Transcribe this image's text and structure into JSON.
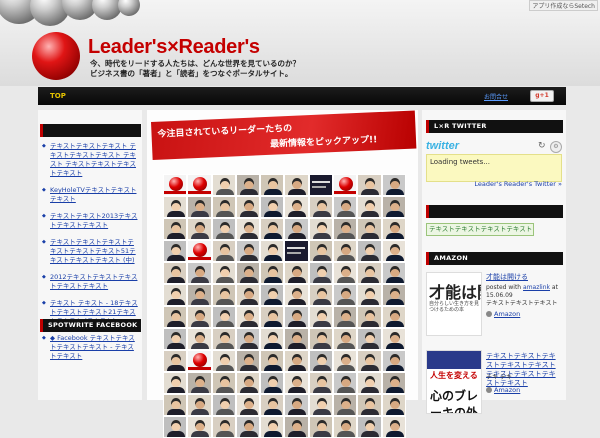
{
  "header": {
    "logo": "Leader's×Reader's",
    "tagline_line1": "今、時代をリードする人たちは、どんな世界を見ているのか？",
    "tagline_line2": "ビジネス書の「著者」と「読者」をつなぐポータルサイト。",
    "corner_text": "アプリ作成ならSetech"
  },
  "nav": {
    "top_label": "TOP",
    "link_label": "お問合せ",
    "gplus_label": "g+1"
  },
  "left_sidebar": {
    "items": [
      "テキストテキストテキスト テキストテキストテキスト テキスト テキストテキストテキストテキスト",
      "KeyHoleTVテキストテキストテキスト",
      "テキストテキスト2013テキストテキストテキスト",
      "テキストテキストテキストテキストテキストテキスト51テキストテキストテキスト (中)",
      "2012テキストテキストテキストテキストテキスト",
      "テキスト テキスト - 18テキストテキストテキスト21テキストテキスト (テキスト)",
      "◆ Facebook テキストテキストテキストテキスト - テキストテキスト"
    ],
    "spotwrite_title": "SPOTWRITE FACEBOOK"
  },
  "main": {
    "banner_line1": "今注目されているリーダーたちの",
    "banner_line2": "最新情報をピックアップ!!"
  },
  "right_sidebar": {
    "twitter_title": "L×R TWITTER",
    "twitter_logo": "twitter",
    "loading": "Loading tweets...",
    "twitter_link": "Leader's Reader's Twitter »",
    "subscribe_label": "テキストテキストテキストテキスト",
    "amazon_title": "AMAZON",
    "books": [
      {
        "cover_title": "才能は開ける",
        "cover_sub": "自分らしい生き方を見つけるための本",
        "title": "才能は開ける",
        "posted_prefix": "posted with",
        "posted_link": "amazlink",
        "posted_suffix": "at",
        "date": "15.06.09",
        "author": "テキストテキストテキスト",
        "amazon_label": "Amazon"
      },
      {
        "cover_banner": "人生を変える",
        "cover_big": "心のブレーキの外し方",
        "title": "テキストテキストテキストテキストテキストテキストテキストテキストテキスト",
        "author": "テキ テキ",
        "amazon_label": "Amazon"
      }
    ]
  },
  "colors": {
    "accent_red": "#c40000",
    "nav_bg": "#111111",
    "link_blue": "#1a3fa8",
    "twitter_blue": "#3ab2e3"
  },
  "photo_tiles": [
    "logo",
    "logo",
    "person",
    "person",
    "person",
    "person",
    "text",
    "logo",
    "person",
    "person",
    "person",
    "person",
    "person",
    "person",
    "person",
    "person",
    "person",
    "person",
    "person",
    "person",
    "person",
    "person",
    "person",
    "person",
    "person",
    "person",
    "person",
    "person",
    "person",
    "person",
    "person",
    "logo",
    "person",
    "person",
    "person",
    "text",
    "person",
    "person",
    "person",
    "person",
    "person",
    "person",
    "person",
    "person",
    "person",
    "person",
    "person",
    "person",
    "person",
    "person",
    "person",
    "person",
    "person",
    "person",
    "person",
    "person",
    "person",
    "person",
    "person",
    "person",
    "person",
    "person",
    "person",
    "person",
    "person",
    "person",
    "person",
    "person",
    "person",
    "person",
    "person",
    "person",
    "person",
    "person",
    "person",
    "person",
    "person",
    "person",
    "person",
    "person",
    "person",
    "logo",
    "person",
    "person",
    "person",
    "person",
    "person",
    "person",
    "person",
    "person",
    "person",
    "person",
    "person",
    "person",
    "person",
    "person",
    "person",
    "person",
    "person",
    "person",
    "person",
    "person",
    "person",
    "person",
    "person",
    "person",
    "person",
    "person",
    "person",
    "person",
    "person",
    "person",
    "person",
    "person",
    "person",
    "person",
    "person",
    "person",
    "person",
    "person"
  ]
}
